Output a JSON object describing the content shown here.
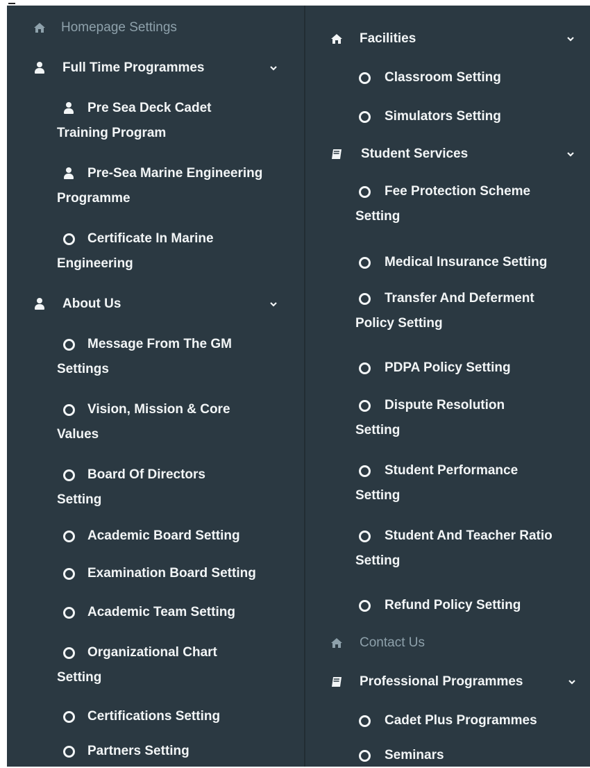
{
  "left": {
    "homepage": "Homepage Settings",
    "full_time": "Full Time Programmes",
    "ft_items": [
      "Pre Sea Deck Cadet Training Program",
      "Pre-Sea Marine Engineering Programme",
      "Certificate In Marine Engineering"
    ],
    "about_us": "About Us",
    "about_items": [
      "Message From The GM Settings",
      "Vision, Mission & Core Values",
      "Board Of Directors Setting",
      "Academic Board Setting",
      "Examination Board Setting",
      "Academic Team Setting",
      "Organizational Chart Setting",
      "Certifications Setting",
      "Partners Setting"
    ]
  },
  "right": {
    "facilities": "Facilities",
    "facility_items": [
      "Classroom Setting",
      "Simulators Setting"
    ],
    "student_services": "Student Services",
    "ss_items": [
      "Fee Protection Scheme Setting",
      "Medical Insurance Setting",
      "Transfer And Deferment Policy Setting",
      "PDPA Policy Setting",
      "Dispute Resolution Setting",
      "Student Performance Setting",
      "Student And Teacher Ratio Setting",
      "Refund Policy Setting"
    ],
    "contact_us": "Contact Us",
    "professional": "Professional Programmes",
    "pro_items": [
      "Cadet Plus Programmes",
      "Seminars"
    ]
  },
  "colors": {
    "sidebar_bg": "#2b3942",
    "text": "#f2f5f6",
    "dim_text": "#8ea1ab"
  }
}
